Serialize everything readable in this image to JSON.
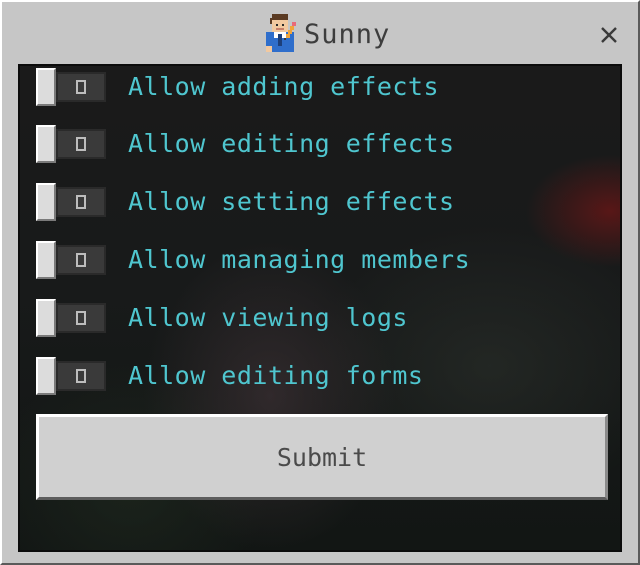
{
  "dialog": {
    "title": "Sunny",
    "title_icon": "avatar-with-pencil-icon",
    "close_icon": "close-icon"
  },
  "toggles": [
    {
      "label": "Allow adding effects",
      "state": "off",
      "glyph": "O"
    },
    {
      "label": "Allow editing effects",
      "state": "off",
      "glyph": "O"
    },
    {
      "label": "Allow setting effects",
      "state": "off",
      "glyph": "O"
    },
    {
      "label": "Allow managing members",
      "state": "off",
      "glyph": "O"
    },
    {
      "label": "Allow viewing logs",
      "state": "off",
      "glyph": "O"
    },
    {
      "label": "Allow editing forms",
      "state": "off",
      "glyph": "O"
    }
  ],
  "submit": {
    "label": "Submit"
  },
  "colors": {
    "label_color": "#4fc6cf",
    "panel_color": "#c6c6c6",
    "button_color": "#d0d0d0"
  }
}
